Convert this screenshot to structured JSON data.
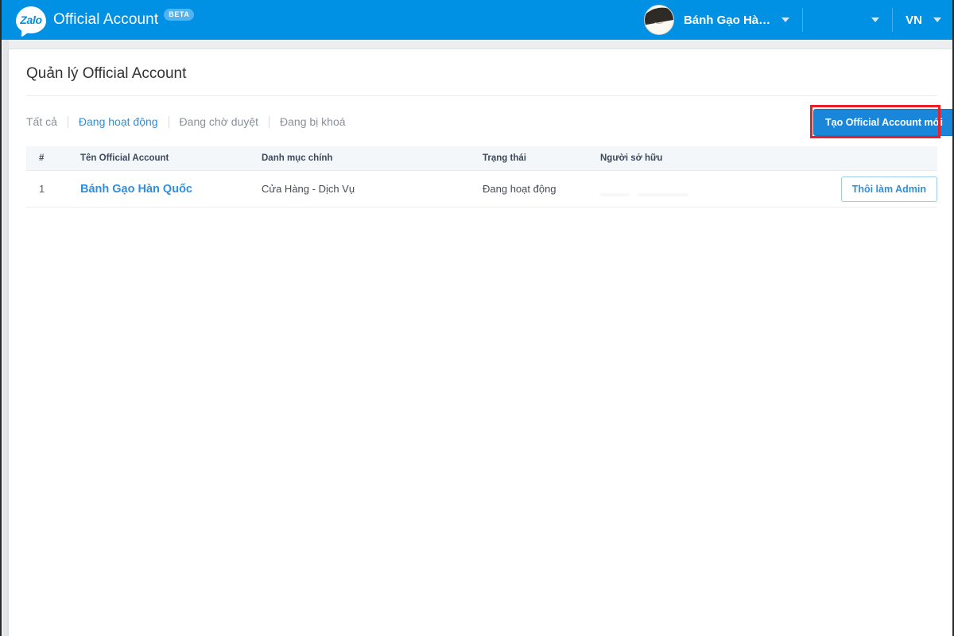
{
  "topbar": {
    "logo_text": "Zalo",
    "brand_title": "Official Account",
    "beta_badge": "BETA",
    "account_name": "Bánh Gạo Hà…",
    "language": "VN"
  },
  "page": {
    "title": "Quản lý Official Account"
  },
  "tabs": [
    {
      "label": "Tất cả",
      "active": false
    },
    {
      "label": "Đang hoạt động",
      "active": true
    },
    {
      "label": "Đang chờ duyệt",
      "active": false
    },
    {
      "label": "Đang bị khoá",
      "active": false
    }
  ],
  "actions": {
    "create_label": "Tạo Official Account mới",
    "annotation_color": "#ee1c25"
  },
  "table": {
    "headers": {
      "index": "#",
      "name": "Tên Official Account",
      "category": "Danh mục chính",
      "status": "Trạng thái",
      "owner": "Người sở hữu"
    },
    "rows": [
      {
        "index": "1",
        "name": "Bánh Gạo Hàn Quốc",
        "category": "Cửa Hàng - Dịch Vụ",
        "status": "Đang hoạt động",
        "owner": "",
        "action_label": "Thôi làm Admin"
      }
    ]
  },
  "colors": {
    "header_blue": "#0091e5",
    "link_blue": "#2f8fdb",
    "button_blue": "#1a86d9",
    "page_bg": "#eceef0"
  }
}
